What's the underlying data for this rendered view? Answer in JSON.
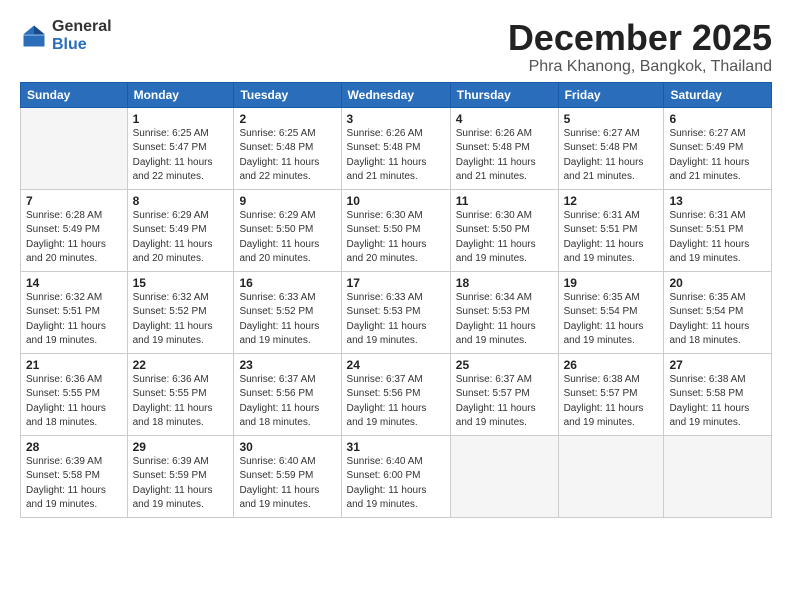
{
  "logo": {
    "general": "General",
    "blue": "Blue"
  },
  "title": "December 2025",
  "location": "Phra Khanong, Bangkok, Thailand",
  "days_of_week": [
    "Sunday",
    "Monday",
    "Tuesday",
    "Wednesday",
    "Thursday",
    "Friday",
    "Saturday"
  ],
  "weeks": [
    [
      {
        "day": "",
        "empty": true
      },
      {
        "day": "1",
        "sunrise": "6:25 AM",
        "sunset": "5:47 PM",
        "daylight": "11 hours and 22 minutes."
      },
      {
        "day": "2",
        "sunrise": "6:25 AM",
        "sunset": "5:48 PM",
        "daylight": "11 hours and 22 minutes."
      },
      {
        "day": "3",
        "sunrise": "6:26 AM",
        "sunset": "5:48 PM",
        "daylight": "11 hours and 21 minutes."
      },
      {
        "day": "4",
        "sunrise": "6:26 AM",
        "sunset": "5:48 PM",
        "daylight": "11 hours and 21 minutes."
      },
      {
        "day": "5",
        "sunrise": "6:27 AM",
        "sunset": "5:48 PM",
        "daylight": "11 hours and 21 minutes."
      },
      {
        "day": "6",
        "sunrise": "6:27 AM",
        "sunset": "5:49 PM",
        "daylight": "11 hours and 21 minutes."
      }
    ],
    [
      {
        "day": "7",
        "sunrise": "6:28 AM",
        "sunset": "5:49 PM",
        "daylight": "11 hours and 20 minutes."
      },
      {
        "day": "8",
        "sunrise": "6:29 AM",
        "sunset": "5:49 PM",
        "daylight": "11 hours and 20 minutes."
      },
      {
        "day": "9",
        "sunrise": "6:29 AM",
        "sunset": "5:50 PM",
        "daylight": "11 hours and 20 minutes."
      },
      {
        "day": "10",
        "sunrise": "6:30 AM",
        "sunset": "5:50 PM",
        "daylight": "11 hours and 20 minutes."
      },
      {
        "day": "11",
        "sunrise": "6:30 AM",
        "sunset": "5:50 PM",
        "daylight": "11 hours and 19 minutes."
      },
      {
        "day": "12",
        "sunrise": "6:31 AM",
        "sunset": "5:51 PM",
        "daylight": "11 hours and 19 minutes."
      },
      {
        "day": "13",
        "sunrise": "6:31 AM",
        "sunset": "5:51 PM",
        "daylight": "11 hours and 19 minutes."
      }
    ],
    [
      {
        "day": "14",
        "sunrise": "6:32 AM",
        "sunset": "5:51 PM",
        "daylight": "11 hours and 19 minutes."
      },
      {
        "day": "15",
        "sunrise": "6:32 AM",
        "sunset": "5:52 PM",
        "daylight": "11 hours and 19 minutes."
      },
      {
        "day": "16",
        "sunrise": "6:33 AM",
        "sunset": "5:52 PM",
        "daylight": "11 hours and 19 minutes."
      },
      {
        "day": "17",
        "sunrise": "6:33 AM",
        "sunset": "5:53 PM",
        "daylight": "11 hours and 19 minutes."
      },
      {
        "day": "18",
        "sunrise": "6:34 AM",
        "sunset": "5:53 PM",
        "daylight": "11 hours and 19 minutes."
      },
      {
        "day": "19",
        "sunrise": "6:35 AM",
        "sunset": "5:54 PM",
        "daylight": "11 hours and 19 minutes."
      },
      {
        "day": "20",
        "sunrise": "6:35 AM",
        "sunset": "5:54 PM",
        "daylight": "11 hours and 18 minutes."
      }
    ],
    [
      {
        "day": "21",
        "sunrise": "6:36 AM",
        "sunset": "5:55 PM",
        "daylight": "11 hours and 18 minutes."
      },
      {
        "day": "22",
        "sunrise": "6:36 AM",
        "sunset": "5:55 PM",
        "daylight": "11 hours and 18 minutes."
      },
      {
        "day": "23",
        "sunrise": "6:37 AM",
        "sunset": "5:56 PM",
        "daylight": "11 hours and 18 minutes."
      },
      {
        "day": "24",
        "sunrise": "6:37 AM",
        "sunset": "5:56 PM",
        "daylight": "11 hours and 19 minutes."
      },
      {
        "day": "25",
        "sunrise": "6:37 AM",
        "sunset": "5:57 PM",
        "daylight": "11 hours and 19 minutes."
      },
      {
        "day": "26",
        "sunrise": "6:38 AM",
        "sunset": "5:57 PM",
        "daylight": "11 hours and 19 minutes."
      },
      {
        "day": "27",
        "sunrise": "6:38 AM",
        "sunset": "5:58 PM",
        "daylight": "11 hours and 19 minutes."
      }
    ],
    [
      {
        "day": "28",
        "sunrise": "6:39 AM",
        "sunset": "5:58 PM",
        "daylight": "11 hours and 19 minutes."
      },
      {
        "day": "29",
        "sunrise": "6:39 AM",
        "sunset": "5:59 PM",
        "daylight": "11 hours and 19 minutes."
      },
      {
        "day": "30",
        "sunrise": "6:40 AM",
        "sunset": "5:59 PM",
        "daylight": "11 hours and 19 minutes."
      },
      {
        "day": "31",
        "sunrise": "6:40 AM",
        "sunset": "6:00 PM",
        "daylight": "11 hours and 19 minutes."
      },
      {
        "day": "",
        "empty": true
      },
      {
        "day": "",
        "empty": true
      },
      {
        "day": "",
        "empty": true
      }
    ]
  ]
}
